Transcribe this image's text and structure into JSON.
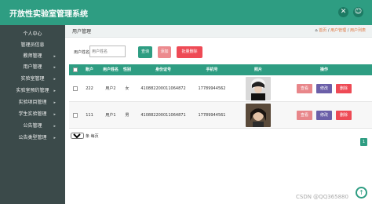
{
  "app": {
    "title": "开放性实验室管理系统"
  },
  "topbar": {
    "tools_icon": "✕",
    "user_icon": "☺"
  },
  "sidebar": {
    "items": [
      {
        "label": "个人中心",
        "arrow": ""
      },
      {
        "label": "管理员信息",
        "arrow": ""
      },
      {
        "label": "教师管理",
        "arrow": "▸"
      },
      {
        "label": "用户管理",
        "arrow": "▸"
      },
      {
        "label": "实验室管理",
        "arrow": "▸"
      },
      {
        "label": "实验室预约管理",
        "arrow": "▸"
      },
      {
        "label": "实验项目管理",
        "arrow": "▸"
      },
      {
        "label": "学生实验管理",
        "arrow": "▸"
      },
      {
        "label": "公告管理",
        "arrow": "▸"
      },
      {
        "label": "公告类型管理",
        "arrow": "▸"
      }
    ]
  },
  "header": {
    "page_title": "用户管理",
    "breadcrumb": {
      "home_icon": "⌂",
      "first": "首页",
      "sep": "/",
      "current": "用户管理",
      "sep2": "/",
      "last": "用户列表"
    }
  },
  "search": {
    "label": "用户姓名",
    "placeholder": "用户姓名",
    "query_label": "查询",
    "add_label": "添加",
    "batch_delete_label": "批量删除"
  },
  "table": {
    "headers": [
      "账户",
      "用户姓名",
      "性别",
      "身份证号",
      "手机号",
      "照片",
      "操作"
    ],
    "rows": [
      {
        "account": "222",
        "name": "用户2",
        "gender": "女",
        "id_card": "410882200011064872",
        "phone": "17789944562"
      },
      {
        "account": "111",
        "name": "用户1",
        "gender": "男",
        "id_card": "410882200011064871",
        "phone": "17789944561"
      }
    ],
    "actions": {
      "view": "查看",
      "edit": "修改",
      "delete": "删除"
    }
  },
  "pager": {
    "page_size": "10",
    "suffix": "条 每页",
    "current_page": "1"
  },
  "watermark": "CSDN @QQ365880"
}
